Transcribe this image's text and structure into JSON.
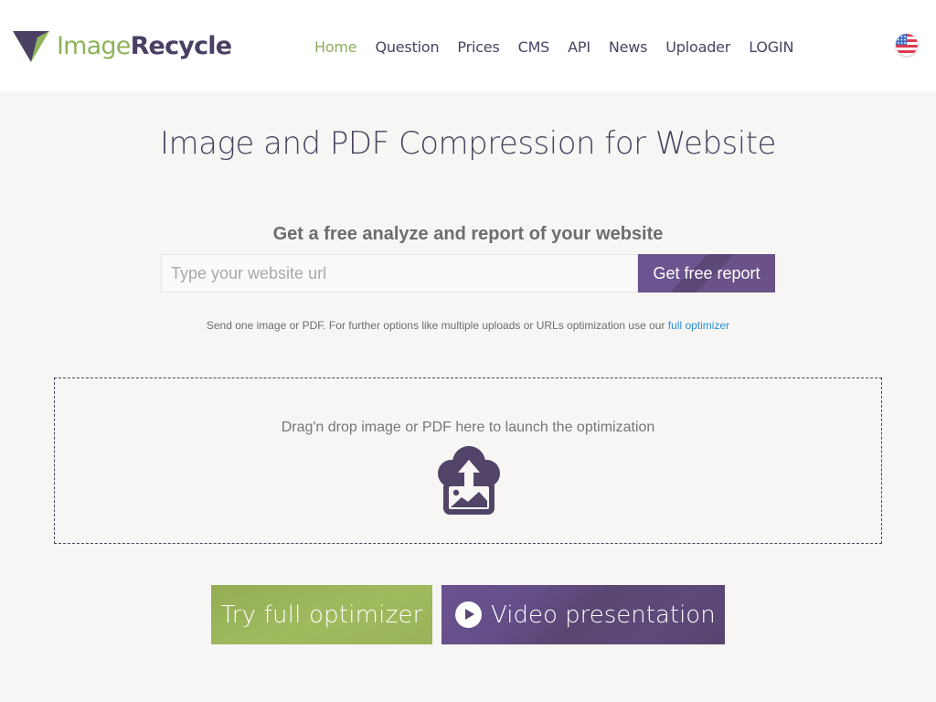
{
  "header": {
    "logo": {
      "light": "Image",
      "bold": "Recycle"
    },
    "nav": [
      {
        "label": "Home",
        "active": true
      },
      {
        "label": "Question",
        "active": false
      },
      {
        "label": "Prices",
        "active": false
      },
      {
        "label": "CMS",
        "active": false
      },
      {
        "label": "API",
        "active": false
      },
      {
        "label": "News",
        "active": false
      },
      {
        "label": "Uploader",
        "active": false
      },
      {
        "label": "LOGIN",
        "active": false
      }
    ],
    "language_flag": "us-flag-icon"
  },
  "main": {
    "title": "Image and PDF Compression for Website",
    "report": {
      "heading": "Get a free analyze and report of your website",
      "input_placeholder": "Type your website url",
      "input_value": "",
      "button_label": "Get free report"
    },
    "hint": {
      "text": "Send one image or PDF. For further options like multiple uploads or URLs optimization use our ",
      "link": "full optimizer"
    },
    "dropzone": {
      "text": "Drag'n drop image or PDF here to launch the optimization",
      "icon": "cloud-upload-image-icon"
    },
    "buttons": {
      "try_label": "Try full optimizer",
      "video_label": "Video presentation"
    }
  },
  "colors": {
    "brand_purple": "#4b4260",
    "brand_green": "#8fb35a",
    "link_blue": "#2a8fd4",
    "background": "#f7f6f4"
  }
}
